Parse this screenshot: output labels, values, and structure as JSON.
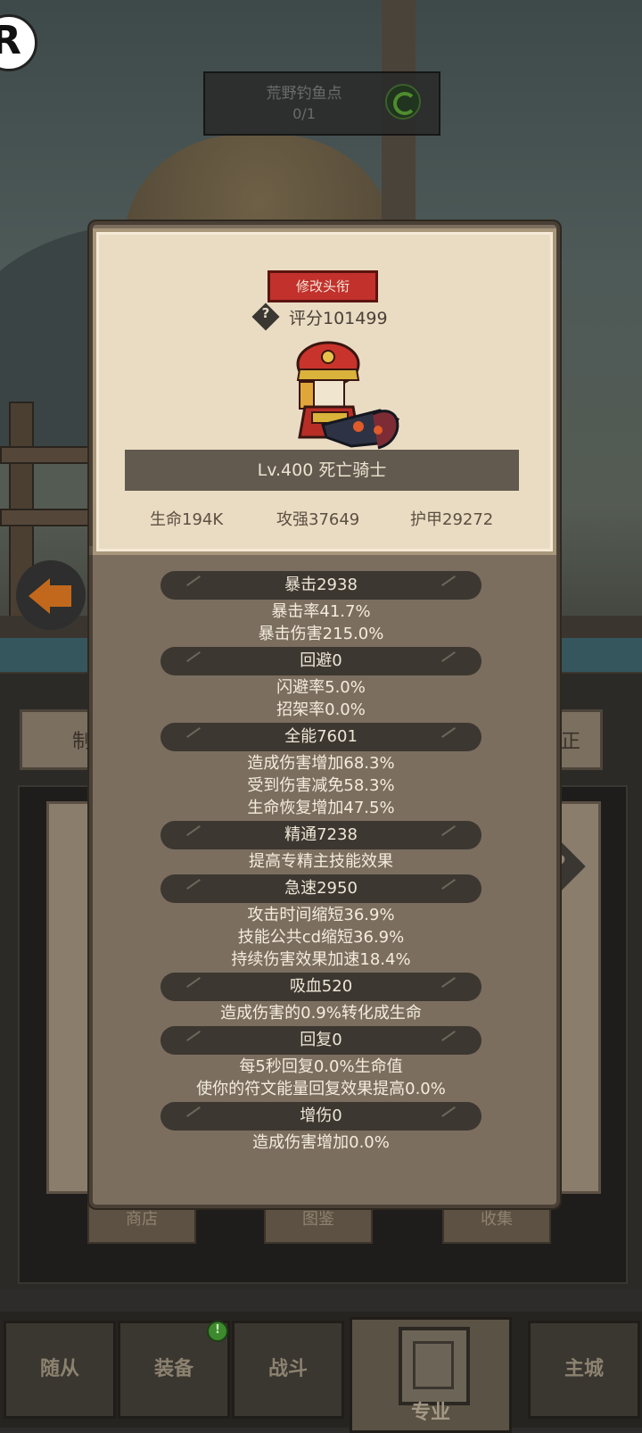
{
  "location": {
    "name": "荒野钓鱼点",
    "count": "0/1"
  },
  "background_tabs": {
    "left_partial": "制",
    "right_partial": "正"
  },
  "background_buttons": [
    "商店",
    "图鉴",
    "收集"
  ],
  "modal": {
    "title_button": "修改头衔",
    "score": "评分101499",
    "level_name": "Lv.400 死亡骑士",
    "stats": {
      "hp": "生命194K",
      "attack": "攻强37649",
      "armor": "护甲29272"
    },
    "attributes": [
      {
        "header": "暴击2938",
        "lines": [
          "暴击率41.7%",
          "暴击伤害215.0%"
        ]
      },
      {
        "header": "回避0",
        "lines": [
          "闪避率5.0%",
          "招架率0.0%"
        ]
      },
      {
        "header": "全能7601",
        "lines": [
          "造成伤害增加68.3%",
          "受到伤害减免58.3%",
          "生命恢复增加47.5%"
        ]
      },
      {
        "header": "精通7238",
        "lines": [
          "提高专精主技能效果"
        ]
      },
      {
        "header": "急速2950",
        "lines": [
          "攻击时间缩短36.9%",
          "技能公共cd缩短36.9%",
          "持续伤害效果加速18.4%"
        ]
      },
      {
        "header": "吸血520",
        "lines": [
          "造成伤害的0.9%转化成生命"
        ]
      },
      {
        "header": "回复0",
        "lines": [
          "每5秒回复0.0%生命值",
          "使你的符文能量回复效果提高0.0%"
        ]
      },
      {
        "header": "增伤0",
        "lines": [
          "造成伤害增加0.0%"
        ]
      }
    ]
  },
  "nav": {
    "tabs": [
      "随从",
      "装备",
      "战斗",
      "专业",
      "主城"
    ],
    "active": "专业"
  },
  "colors": {
    "title_button": "#c2312c",
    "card": "#eadcc3",
    "panel": "#7b6e5f",
    "header_pill": "#3d3731"
  }
}
